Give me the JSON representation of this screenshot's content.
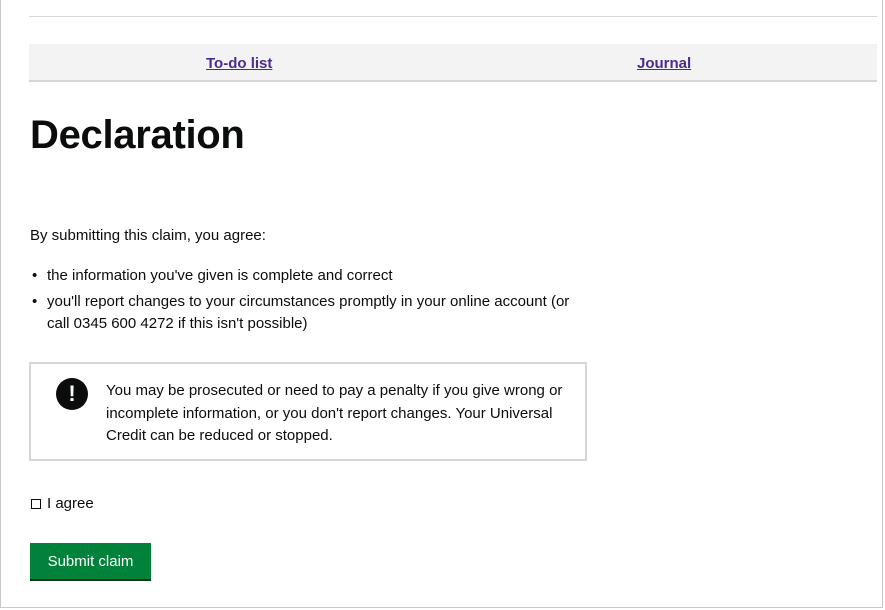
{
  "nav": {
    "todo_label": "To-do list",
    "journal_label": "Journal"
  },
  "page": {
    "title": "Declaration",
    "intro": "By submitting this claim, you agree:",
    "bullets": [
      "the information you've given is complete and correct",
      "you'll report changes to your circumstances promptly in your online account (or call 0345 600 4272 if this isn't possible)"
    ],
    "bullet_symbol": "•"
  },
  "warning": {
    "icon": "exclamation-icon",
    "icon_glyph": "!",
    "text": "You may be prosecuted or need to pay a penalty if you give wrong or incomplete information, or you don't report changes. Your Universal Credit can be reduced or stopped."
  },
  "form": {
    "agree_label": "I agree",
    "agree_checked": false,
    "submit_label": "Submit claim"
  },
  "colors": {
    "link": "#4c2c92",
    "button": "#00823b",
    "text": "#0b0c0c"
  }
}
